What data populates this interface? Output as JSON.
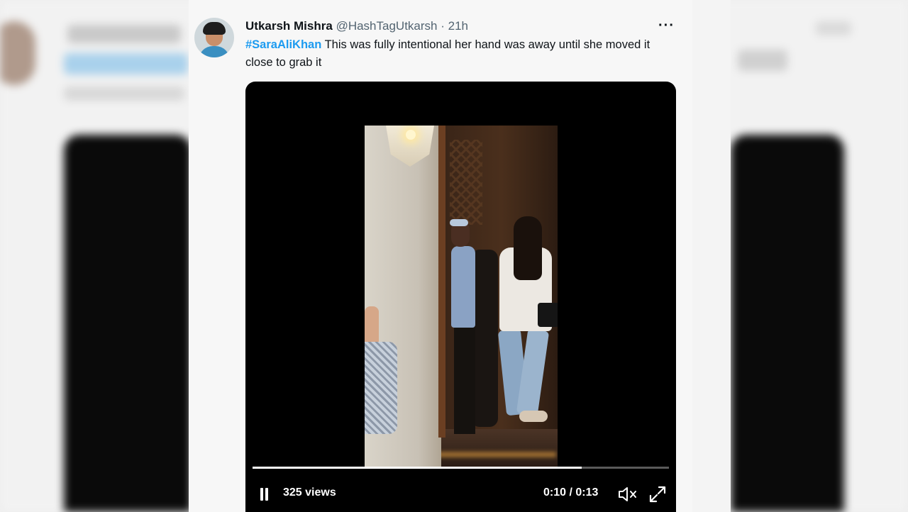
{
  "tweet": {
    "author_name": "Utkarsh Mishra",
    "handle": "@HashTagUtkarsh",
    "separator": "·",
    "time": "21h",
    "more_icon": "more-horizontal-icon",
    "hashtag": "#SaraAliKhan",
    "text": "This was fully intentional her hand was away until she moved it close to grab it"
  },
  "video": {
    "views": "325 views",
    "current_time": "0:10",
    "duration": "0:13",
    "time_separator": " / ",
    "progress_fraction": 0.79,
    "pause_icon": "pause-icon",
    "mute_icon": "volume-muted-icon",
    "fullscreen_icon": "expand-icon"
  },
  "colors": {
    "hashtag": "#1d9bf0",
    "video_bg": "#000000",
    "card_bg": "#f7f7f7"
  }
}
